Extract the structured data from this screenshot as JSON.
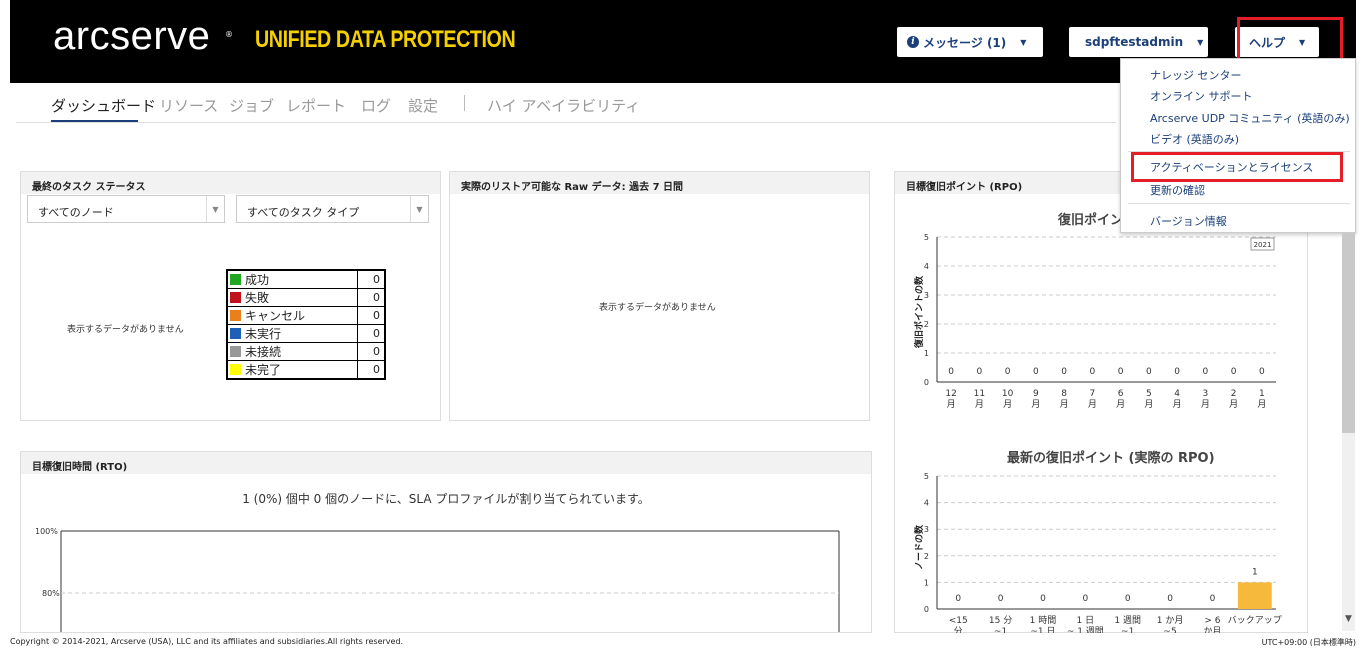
{
  "header": {
    "logo": "arcserve",
    "logo_reg": "®",
    "product": "UNIFIED DATA PROTECTION",
    "messages_label": "メッセージ (1)",
    "user_label": "sdpftestadmin",
    "help_label": "ヘルプ",
    "caret": "▼",
    "info_glyph": "i"
  },
  "nav": {
    "items": [
      "ダッシュボード",
      "リソース",
      "ジョブ",
      "レポート",
      "ログ",
      "設定",
      "ハイ アベイラビリティ"
    ]
  },
  "task_status": {
    "title": "最終のタスク ステータス",
    "node_select": "すべてのノード",
    "type_select": "すべてのタスク タイプ",
    "no_data": "表示するデータがありません",
    "legend": [
      {
        "label": "成功",
        "count": "0",
        "color": "#22a722"
      },
      {
        "label": "失敗",
        "count": "0",
        "color": "#c0121a"
      },
      {
        "label": "キャンセル",
        "count": "0",
        "color": "#e8801c"
      },
      {
        "label": "未実行",
        "count": "0",
        "color": "#1f5fb8"
      },
      {
        "label": "未接続",
        "count": "0",
        "color": "#999999"
      },
      {
        "label": "未完了",
        "count": "0",
        "color": "#ffff00"
      }
    ]
  },
  "raw_data": {
    "title": "実際のリストア可能な Raw データ: 過去 7 日間",
    "no_data": "表示するデータがありません"
  },
  "rto": {
    "title": "目標復旧時間 (RTO)",
    "message": "1 (0%) 個中 0 個のノードに、SLA プロファイルが割り当てられています。",
    "y_ticks": [
      "100%",
      "80%"
    ]
  },
  "rpo": {
    "title": "目標復旧ポイント (RPO)",
    "chart1_title": "復旧ポイン",
    "chart1_ylabel": "復旧ポイントの数",
    "chart1_badge": "2021",
    "chart2_title": "最新の復旧ポイント (実際の RPO)",
    "chart2_ylabel": "ノードの数"
  },
  "chart_data": [
    {
      "type": "bar",
      "title": "",
      "ylabel": "復旧ポイントの数",
      "categories": [
        "12 月",
        "11 月",
        "10 月",
        "9 月",
        "8 月",
        "7 月",
        "6 月",
        "5 月",
        "4 月",
        "3 月",
        "2 月",
        "1 月"
      ],
      "values": [
        0,
        0,
        0,
        0,
        0,
        0,
        0,
        0,
        0,
        0,
        0,
        0
      ],
      "y_ticks": [
        "0",
        "1",
        "2",
        "3",
        "4",
        "5"
      ],
      "ylim": [
        0,
        5
      ],
      "grid": true
    },
    {
      "type": "bar",
      "title": "最新の復旧ポイント (実際の RPO)",
      "ylabel": "ノードの数",
      "categories": [
        "<15 分",
        "15 分 ~1",
        "1 時間 ~1 日",
        "1 日 ~ 1 週間",
        "1 週間 ~1",
        "1 か月 ~5",
        "> 6 か月",
        "バックアップ"
      ],
      "values": [
        0,
        0,
        0,
        0,
        0,
        0,
        0,
        1
      ],
      "bar_color": "#f6b93b",
      "y_ticks": [
        "0",
        "1",
        "2",
        "3",
        "4",
        "5"
      ],
      "ylim": [
        0,
        5
      ],
      "grid": true
    }
  ],
  "help_menu": {
    "items": [
      "ナレッジ センター",
      "オンライン サポート",
      "Arcserve UDP コミュニティ (英語のみ)",
      "ビデオ (英語のみ)",
      "アクティベーションとライセンス",
      "更新の確認",
      "バージョン情報"
    ]
  },
  "footer": {
    "copyright": "Copyright © 2014-2021, Arcserve (USA), LLC and its affiliates and subsidiaries.All rights reserved.",
    "timezone": "UTC+09:00 (日本標準時)"
  },
  "scroll_arrow": "▼"
}
